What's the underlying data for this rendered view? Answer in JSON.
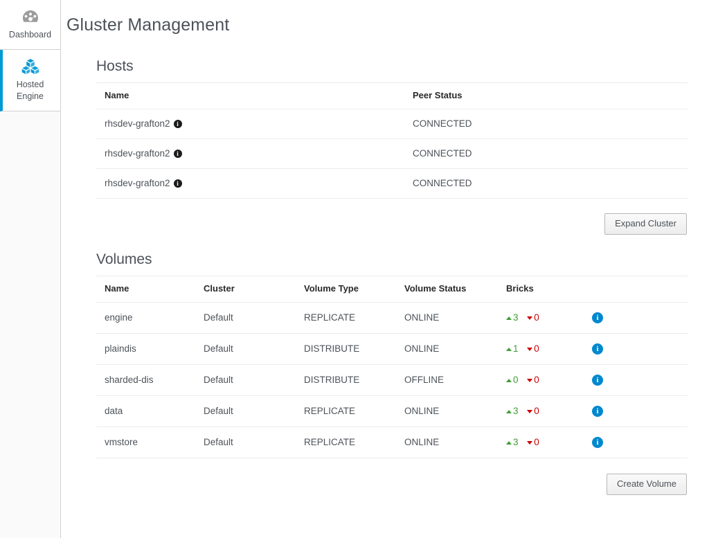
{
  "sidebar": {
    "items": [
      {
        "label": "Dashboard",
        "icon": "dashboard-gauge-icon",
        "active": false
      },
      {
        "label": "Hosted Engine",
        "icon": "cubes-icon",
        "active": true
      }
    ]
  },
  "header": {
    "title": "Gluster Management"
  },
  "hosts": {
    "title": "Hosts",
    "columns": [
      "Name",
      "Peer Status"
    ],
    "rows": [
      {
        "name": "rhsdev-grafton2",
        "peer_status": "CONNECTED",
        "info_icon": "info-icon"
      },
      {
        "name": "rhsdev-grafton2",
        "peer_status": "CONNECTED",
        "info_icon": "info-icon"
      },
      {
        "name": "rhsdev-grafton2",
        "peer_status": "CONNECTED",
        "info_icon": "info-icon"
      }
    ],
    "action_label": "Expand Cluster"
  },
  "volumes": {
    "title": "Volumes",
    "columns": [
      "Name",
      "Cluster",
      "Volume Type",
      "Volume Status",
      "Bricks",
      ""
    ],
    "rows": [
      {
        "name": "engine",
        "cluster": "Default",
        "type": "REPLICATE",
        "status": "ONLINE",
        "bricks_up": "3",
        "bricks_down": "0",
        "info_icon": "info-icon"
      },
      {
        "name": "plaindis",
        "cluster": "Default",
        "type": "DISTRIBUTE",
        "status": "ONLINE",
        "bricks_up": "1",
        "bricks_down": "0",
        "info_icon": "info-icon"
      },
      {
        "name": "sharded-dis",
        "cluster": "Default",
        "type": "DISTRIBUTE",
        "status": "OFFLINE",
        "bricks_up": "0",
        "bricks_down": "0",
        "info_icon": "info-icon"
      },
      {
        "name": "data",
        "cluster": "Default",
        "type": "REPLICATE",
        "status": "ONLINE",
        "bricks_up": "3",
        "bricks_down": "0",
        "info_icon": "info-icon"
      },
      {
        "name": "vmstore",
        "cluster": "Default",
        "type": "REPLICATE",
        "status": "ONLINE",
        "bricks_up": "3",
        "bricks_down": "0",
        "info_icon": "info-icon"
      }
    ],
    "action_label": "Create Volume"
  },
  "colors": {
    "accent": "#0099d3",
    "info_blue": "#0088ce",
    "brick_up_green": "#3f9c35",
    "brick_down_red": "#cc0000",
    "text": "#4d5258"
  },
  "glyphs": {
    "info": "i"
  }
}
